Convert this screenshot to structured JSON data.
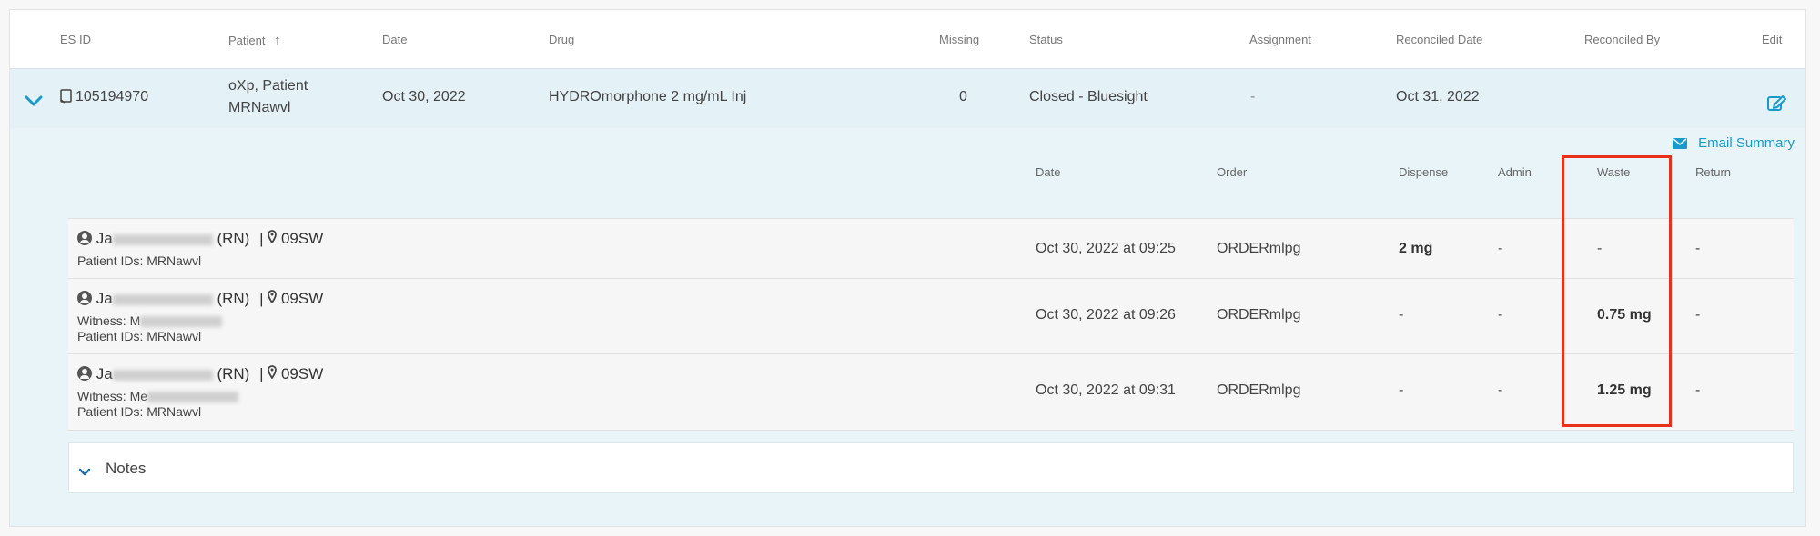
{
  "table": {
    "headers": {
      "es_id": "ES ID",
      "patient": "Patient",
      "sort_arrow": "↑",
      "date": "Date",
      "drug": "Drug",
      "missing": "Missing",
      "status": "Status",
      "assignment": "Assignment",
      "reconciled_date": "Reconciled Date",
      "reconciled_by": "Reconciled By",
      "edit": "Edit"
    },
    "row": {
      "es_id": "105194970",
      "patient_line1": "oXp, Patient",
      "patient_line2": "MRNawvl",
      "date": "Oct 30, 2022",
      "drug": "HYDROmorphone 2 mg/mL Inj",
      "missing": "0",
      "status": "Closed - Bluesight",
      "assignment": "-",
      "reconciled_date": "Oct 31, 2022",
      "reconciled_by": ""
    }
  },
  "detail": {
    "email_summary": "Email Summary",
    "headers": {
      "date": "Date",
      "order": "Order",
      "dispense": "Dispense",
      "admin": "Admin",
      "waste": "Waste",
      "return": "Return"
    },
    "rows": [
      {
        "name_prefix": "Ja",
        "role": "(RN)",
        "location": "09SW",
        "witness": "",
        "patient_ids": "Patient IDs: MRNawvl",
        "date": "Oct 30, 2022 at 09:25",
        "order": "ORDERmlpg",
        "dispense": "2 mg",
        "admin": "-",
        "waste": "-",
        "return": "-"
      },
      {
        "name_prefix": "Ja",
        "role": "(RN)",
        "location": "09SW",
        "witness": "Witness: M",
        "patient_ids": "Patient IDs: MRNawvl",
        "date": "Oct 30, 2022 at 09:26",
        "order": "ORDERmlpg",
        "dispense": "-",
        "admin": "-",
        "waste": "0.75 mg",
        "return": "-"
      },
      {
        "name_prefix": "Ja",
        "role": "(RN)",
        "location": "09SW",
        "witness": "Witness: Me",
        "patient_ids": "Patient IDs: MRNawvl",
        "date": "Oct 30, 2022 at 09:31",
        "order": "ORDERmlpg",
        "dispense": "-",
        "admin": "-",
        "waste": "1.25 mg",
        "return": "-"
      }
    ],
    "notes_label": "Notes",
    "separator": "|"
  },
  "colors": {
    "accent": "#1a9ac9",
    "highlight_box": "#e8301a",
    "expanded_bg": "#e8f4f8"
  },
  "icons": [
    "chevron-down-icon",
    "document-icon",
    "edit-icon",
    "envelope-icon",
    "person-icon",
    "map-pin-icon"
  ]
}
